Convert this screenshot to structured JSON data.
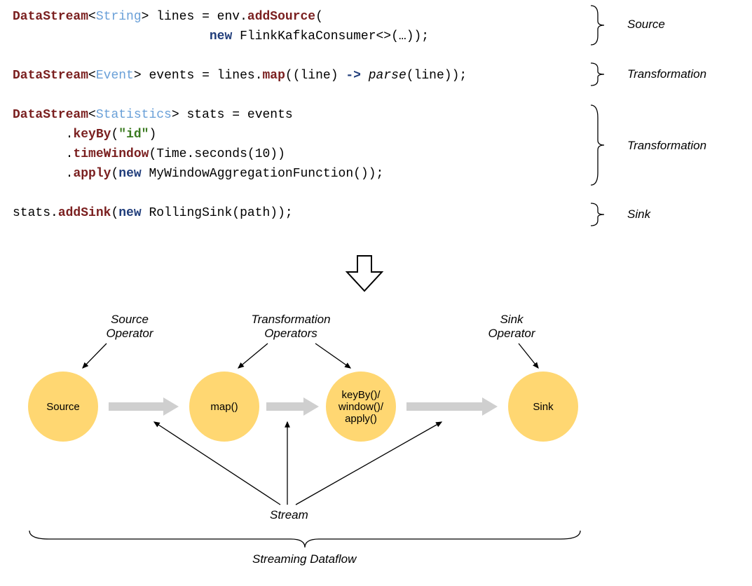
{
  "code": {
    "line1a": "DataStream",
    "line1b": "String",
    "line1c": "> lines = env.",
    "line1d": "addSource",
    "line1e": "(",
    "line2a": "new",
    "line2b": " FlinkKafkaConsumer<>(…));",
    "line3a": "DataStream",
    "line3b": "Event",
    "line3c": "> events = lines.",
    "line3d": "map",
    "line3e": "((line) ",
    "line3f": "->",
    "line3g": " ",
    "line3h": "parse",
    "line3i": "(line));",
    "line4a": "DataStream",
    "line4b": "Statistics",
    "line4c": "> stats = events",
    "line5a": ".",
    "line5b": "keyBy",
    "line5c": "(",
    "line5d": "\"id\"",
    "line5e": ")",
    "line6a": ".",
    "line6b": "timeWindow",
    "line6c": "(Time.seconds(10))",
    "line7a": ".",
    "line7b": "apply",
    "line7c": "(",
    "line7d": "new",
    "line7e": " MyWindowAggregationFunction());",
    "line8a": "stats.",
    "line8b": "addSink",
    "line8c": "(",
    "line8d": "new",
    "line8e": " RollingSink(path));"
  },
  "side_labels": {
    "source": "Source",
    "transformation1": "Transformation",
    "transformation2": "Transformation",
    "sink": "Sink"
  },
  "diagram": {
    "source_op_label": "Source\nOperator",
    "transform_op_label": "Transformation\nOperators",
    "sink_op_label": "Sink\nOperator",
    "circle_source": "Source",
    "circle_map": "map()",
    "circle_keyby": "keyBy()/\nwindow()/\napply()",
    "circle_sink": "Sink",
    "stream": "Stream",
    "dataflow": "Streaming Dataflow"
  }
}
